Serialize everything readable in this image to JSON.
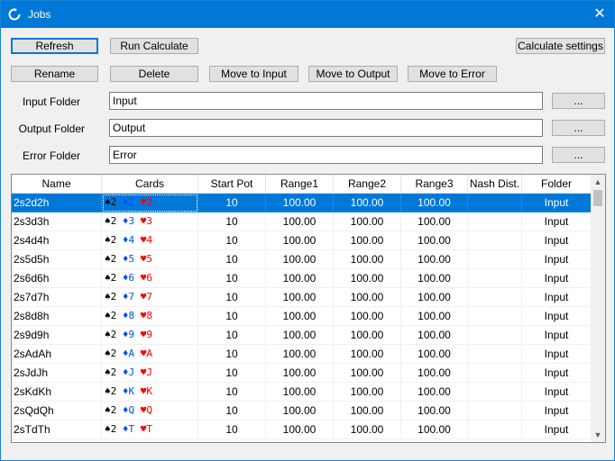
{
  "window": {
    "title": "Jobs",
    "close_glyph": "✕"
  },
  "toolbar": {
    "refresh": "Refresh",
    "run_calculate": "Run Calculate",
    "calculate_settings": "Calculate settings",
    "rename": "Rename",
    "delete": "Delete",
    "move_to_input": "Move to Input",
    "move_to_output": "Move to Output",
    "move_to_error": "Move to Error"
  },
  "folders": {
    "input_label": "Input Folder",
    "input_value": "Input",
    "output_label": "Output Folder",
    "output_value": "Output",
    "error_label": "Error Folder",
    "error_value": "Error",
    "browse_label": "..."
  },
  "grid": {
    "columns": [
      "Name",
      "Cards",
      "Start Pot",
      "Range1",
      "Range2",
      "Range3",
      "Nash Dist.",
      "Folder"
    ],
    "selected_row": 0,
    "rows": [
      {
        "name": "2s2d2h",
        "cards": {
          "s": "2",
          "d": "2",
          "h": "2"
        },
        "start_pot": "10",
        "range1": "100.00",
        "range2": "100.00",
        "range3": "100.00",
        "nash": "",
        "folder": "Input"
      },
      {
        "name": "2s3d3h",
        "cards": {
          "s": "2",
          "d": "3",
          "h": "3"
        },
        "start_pot": "10",
        "range1": "100.00",
        "range2": "100.00",
        "range3": "100.00",
        "nash": "",
        "folder": "Input"
      },
      {
        "name": "2s4d4h",
        "cards": {
          "s": "2",
          "d": "4",
          "h": "4"
        },
        "start_pot": "10",
        "range1": "100.00",
        "range2": "100.00",
        "range3": "100.00",
        "nash": "",
        "folder": "Input"
      },
      {
        "name": "2s5d5h",
        "cards": {
          "s": "2",
          "d": "5",
          "h": "5"
        },
        "start_pot": "10",
        "range1": "100.00",
        "range2": "100.00",
        "range3": "100.00",
        "nash": "",
        "folder": "Input"
      },
      {
        "name": "2s6d6h",
        "cards": {
          "s": "2",
          "d": "6",
          "h": "6"
        },
        "start_pot": "10",
        "range1": "100.00",
        "range2": "100.00",
        "range3": "100.00",
        "nash": "",
        "folder": "Input"
      },
      {
        "name": "2s7d7h",
        "cards": {
          "s": "2",
          "d": "7",
          "h": "7"
        },
        "start_pot": "10",
        "range1": "100.00",
        "range2": "100.00",
        "range3": "100.00",
        "nash": "",
        "folder": "Input"
      },
      {
        "name": "2s8d8h",
        "cards": {
          "s": "2",
          "d": "8",
          "h": "8"
        },
        "start_pot": "10",
        "range1": "100.00",
        "range2": "100.00",
        "range3": "100.00",
        "nash": "",
        "folder": "Input"
      },
      {
        "name": "2s9d9h",
        "cards": {
          "s": "2",
          "d": "9",
          "h": "9"
        },
        "start_pot": "10",
        "range1": "100.00",
        "range2": "100.00",
        "range3": "100.00",
        "nash": "",
        "folder": "Input"
      },
      {
        "name": "2sAdAh",
        "cards": {
          "s": "2",
          "d": "A",
          "h": "A"
        },
        "start_pot": "10",
        "range1": "100.00",
        "range2": "100.00",
        "range3": "100.00",
        "nash": "",
        "folder": "Input"
      },
      {
        "name": "2sJdJh",
        "cards": {
          "s": "2",
          "d": "J",
          "h": "J"
        },
        "start_pot": "10",
        "range1": "100.00",
        "range2": "100.00",
        "range3": "100.00",
        "nash": "",
        "folder": "Input"
      },
      {
        "name": "2sKdKh",
        "cards": {
          "s": "2",
          "d": "K",
          "h": "K"
        },
        "start_pot": "10",
        "range1": "100.00",
        "range2": "100.00",
        "range3": "100.00",
        "nash": "",
        "folder": "Input"
      },
      {
        "name": "2sQdQh",
        "cards": {
          "s": "2",
          "d": "Q",
          "h": "Q"
        },
        "start_pot": "10",
        "range1": "100.00",
        "range2": "100.00",
        "range3": "100.00",
        "nash": "",
        "folder": "Input"
      },
      {
        "name": "2sTdTh",
        "cards": {
          "s": "2",
          "d": "T",
          "h": "T"
        },
        "start_pot": "10",
        "range1": "100.00",
        "range2": "100.00",
        "range3": "100.00",
        "nash": "",
        "folder": "Input"
      }
    ]
  },
  "suits": {
    "spade": "♠",
    "diamond": "♦",
    "heart": "♥"
  },
  "colors": {
    "accent": "#0078d7",
    "diamond": "#0050ff",
    "heart": "#ff0000"
  },
  "icons": {
    "app": "refresh-arrows-icon",
    "close": "close-icon"
  }
}
